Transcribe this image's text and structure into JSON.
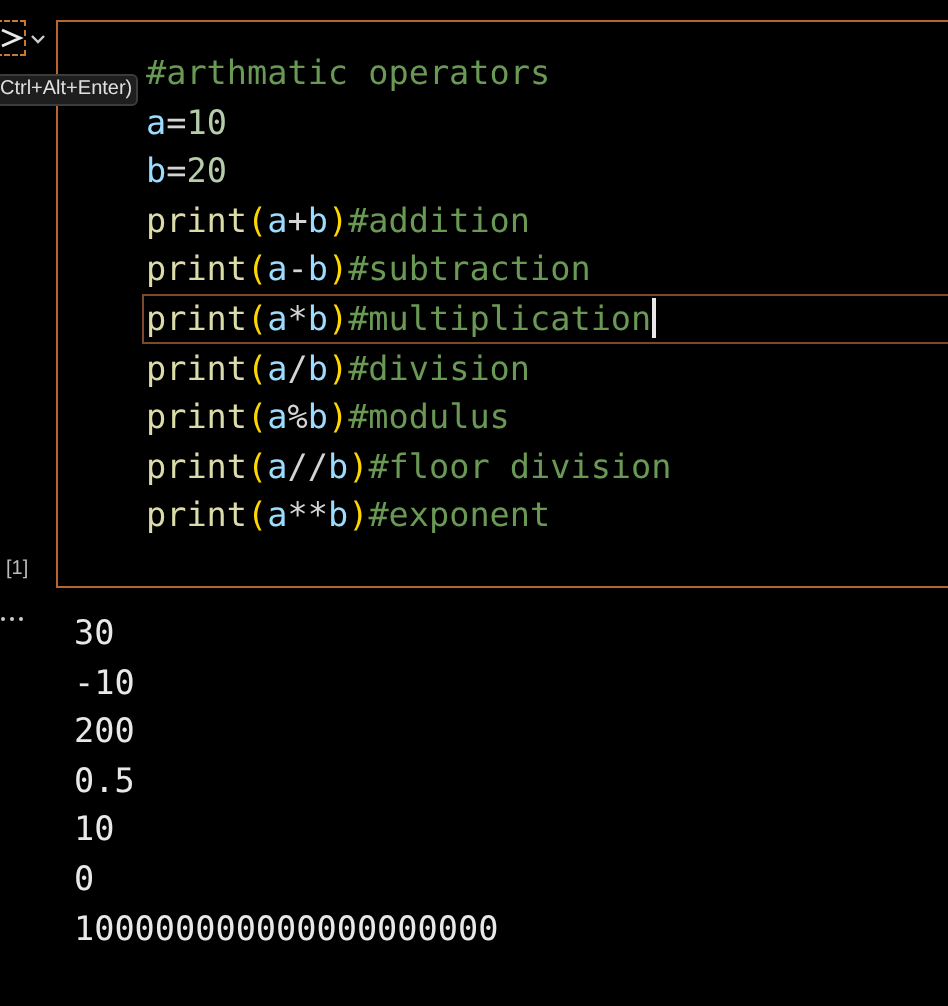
{
  "cell": {
    "execution_count": "[1]",
    "run_tooltip": "Ctrl+Alt+Enter)",
    "lines": [
      {
        "current": false,
        "tokens": [
          {
            "kind": "comment",
            "text": "#arthmatic operators"
          }
        ]
      },
      {
        "current": false,
        "tokens": [
          {
            "kind": "var",
            "text": "a"
          },
          {
            "kind": "op",
            "text": "="
          },
          {
            "kind": "num",
            "text": "10"
          }
        ]
      },
      {
        "current": false,
        "tokens": [
          {
            "kind": "var",
            "text": "b"
          },
          {
            "kind": "op",
            "text": "="
          },
          {
            "kind": "num",
            "text": "20"
          }
        ]
      },
      {
        "current": false,
        "tokens": [
          {
            "kind": "func",
            "text": "print"
          },
          {
            "kind": "paren",
            "text": "("
          },
          {
            "kind": "var",
            "text": "a"
          },
          {
            "kind": "op",
            "text": "+"
          },
          {
            "kind": "var",
            "text": "b"
          },
          {
            "kind": "paren",
            "text": ")"
          },
          {
            "kind": "comment",
            "text": "#addition"
          }
        ]
      },
      {
        "current": false,
        "tokens": [
          {
            "kind": "func",
            "text": "print"
          },
          {
            "kind": "paren",
            "text": "("
          },
          {
            "kind": "var",
            "text": "a"
          },
          {
            "kind": "op",
            "text": "-"
          },
          {
            "kind": "var",
            "text": "b"
          },
          {
            "kind": "paren",
            "text": ")"
          },
          {
            "kind": "comment",
            "text": "#subtraction"
          }
        ]
      },
      {
        "current": true,
        "tokens": [
          {
            "kind": "func",
            "text": "print"
          },
          {
            "kind": "paren",
            "text": "("
          },
          {
            "kind": "var",
            "text": "a"
          },
          {
            "kind": "op",
            "text": "*"
          },
          {
            "kind": "var",
            "text": "b"
          },
          {
            "kind": "paren",
            "text": ")"
          },
          {
            "kind": "comment",
            "text": "#multiplication"
          }
        ]
      },
      {
        "current": false,
        "tokens": [
          {
            "kind": "func",
            "text": "print"
          },
          {
            "kind": "paren",
            "text": "("
          },
          {
            "kind": "var",
            "text": "a"
          },
          {
            "kind": "op",
            "text": "/"
          },
          {
            "kind": "var",
            "text": "b"
          },
          {
            "kind": "paren",
            "text": ")"
          },
          {
            "kind": "comment",
            "text": "#division"
          }
        ]
      },
      {
        "current": false,
        "tokens": [
          {
            "kind": "func",
            "text": "print"
          },
          {
            "kind": "paren",
            "text": "("
          },
          {
            "kind": "var",
            "text": "a"
          },
          {
            "kind": "op",
            "text": "%"
          },
          {
            "kind": "var",
            "text": "b"
          },
          {
            "kind": "paren",
            "text": ")"
          },
          {
            "kind": "comment",
            "text": "#modulus"
          }
        ]
      },
      {
        "current": false,
        "tokens": [
          {
            "kind": "func",
            "text": "print"
          },
          {
            "kind": "paren",
            "text": "("
          },
          {
            "kind": "var",
            "text": "a"
          },
          {
            "kind": "op",
            "text": "//"
          },
          {
            "kind": "var",
            "text": "b"
          },
          {
            "kind": "paren",
            "text": ")"
          },
          {
            "kind": "comment",
            "text": "#floor division"
          }
        ]
      },
      {
        "current": false,
        "tokens": [
          {
            "kind": "func",
            "text": "print"
          },
          {
            "kind": "paren",
            "text": "("
          },
          {
            "kind": "var",
            "text": "a"
          },
          {
            "kind": "op",
            "text": "**"
          },
          {
            "kind": "var",
            "text": "b"
          },
          {
            "kind": "paren",
            "text": ")"
          },
          {
            "kind": "comment",
            "text": "#exponent"
          }
        ]
      }
    ]
  },
  "output": {
    "lines": [
      "30",
      "-10",
      "200",
      "0.5",
      "10",
      "0",
      "100000000000000000000"
    ]
  }
}
